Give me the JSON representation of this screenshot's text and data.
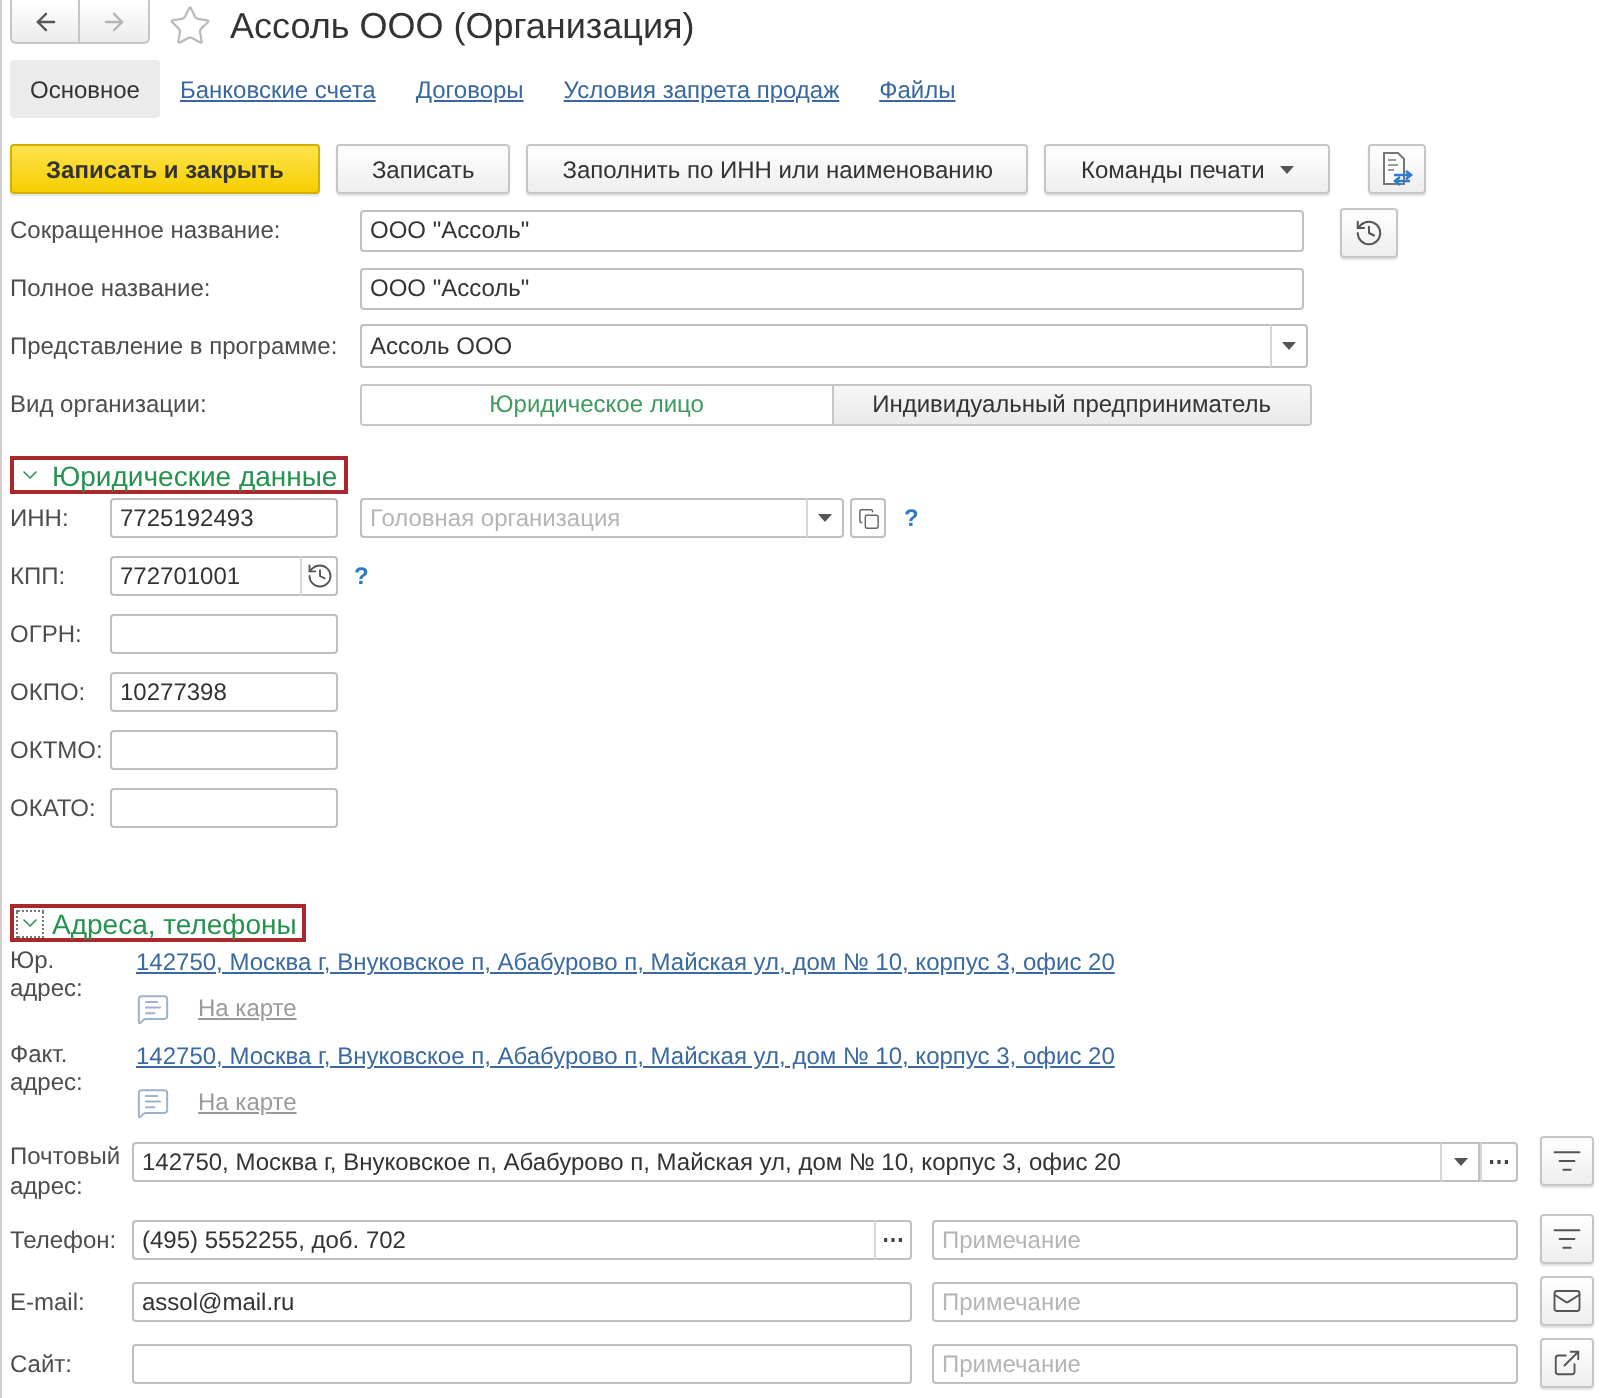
{
  "window": {
    "title": "Ассоль ООО (Организация)",
    "favorite": false
  },
  "nav": [
    {
      "kind": "back",
      "disabled": false
    },
    {
      "kind": "forward",
      "disabled": true
    }
  ],
  "tabs": [
    {
      "label": "Основное",
      "selected": true
    },
    {
      "label": "Банковские счета",
      "selected": false
    },
    {
      "label": "Договоры",
      "selected": false
    },
    {
      "label": "Условия запрета продаж",
      "selected": false
    },
    {
      "label": "Файлы",
      "selected": false
    }
  ],
  "toolbar": [
    {
      "kind": "primary",
      "label": "Записать и закрыть"
    },
    {
      "kind": "plain",
      "label": "Записать"
    },
    {
      "kind": "plain",
      "label": "Заполнить по ИНН или наименованию"
    },
    {
      "kind": "menu",
      "label": "Команды печати"
    },
    {
      "kind": "icon"
    }
  ],
  "main_fields": [
    {
      "kind": "text",
      "label": "Сокращенное название:",
      "value": "ООО \"Ассоль\"",
      "history": true
    },
    {
      "kind": "text",
      "label": "Полное название:",
      "value": "ООО \"Ассоль\"",
      "history": false
    },
    {
      "kind": "dropdown",
      "label": "Представление в программе:",
      "value": "Ассоль ООО",
      "history": false
    }
  ],
  "org_type": {
    "label": "Вид организации:",
    "options": [
      {
        "label": "Юридическое лицо",
        "selected": true
      },
      {
        "label": "Индивидуальный предприниматель",
        "selected": false
      }
    ]
  },
  "legal_section": {
    "title": "Юридические данные",
    "expanded": true,
    "highlighted": true,
    "focused": false,
    "fields": [
      {
        "label": "ИНН:",
        "value": "7725192493",
        "history": false,
        "help": "?",
        "parent_org": {
          "placeholder": "Головная организация"
        }
      },
      {
        "label": "КПП:",
        "value": "772701001",
        "history": true,
        "help": "?"
      },
      {
        "label": "ОГРН:",
        "history": false
      },
      {
        "label": "ОКПО:",
        "value": "10277398",
        "history": false
      },
      {
        "label": "ОКТМО:",
        "history": false
      },
      {
        "label": "ОКАТО:",
        "history": false
      }
    ]
  },
  "contacts_section": {
    "title": "Адреса, телефоны",
    "expanded": true,
    "highlighted": true,
    "focused": true,
    "addresses": [
      {
        "label": "Юр. адрес:",
        "value": "142750, Москва г, Внуковское п, Абабурово п, Майская ул, дом № 10, корпус 3, офис 20",
        "map_link": "На карте"
      },
      {
        "label": "Факт. адрес:",
        "value": "142750, Москва г, Внуковское п, Абабурово п, Майская ул, дом № 10, корпус 3, офис 20",
        "map_link": "На карте"
      }
    ],
    "fields": [
      {
        "kind": "address",
        "label": "Почтовый адрес:",
        "value": "142750, Москва г, Внуковское п, Абабурово п, Майская ул, дом № 10, корпус 3, офис 20"
      },
      {
        "kind": "phone",
        "label": "Телефон:",
        "value": "(495) 5552255, доб. 702",
        "note_placeholder": "Примечание"
      },
      {
        "kind": "email",
        "label": "E-mail:",
        "value": "assol@mail.ru",
        "note_placeholder": "Примечание"
      },
      {
        "kind": "site",
        "label": "Сайт:",
        "note_placeholder": "Примечание"
      }
    ]
  }
}
